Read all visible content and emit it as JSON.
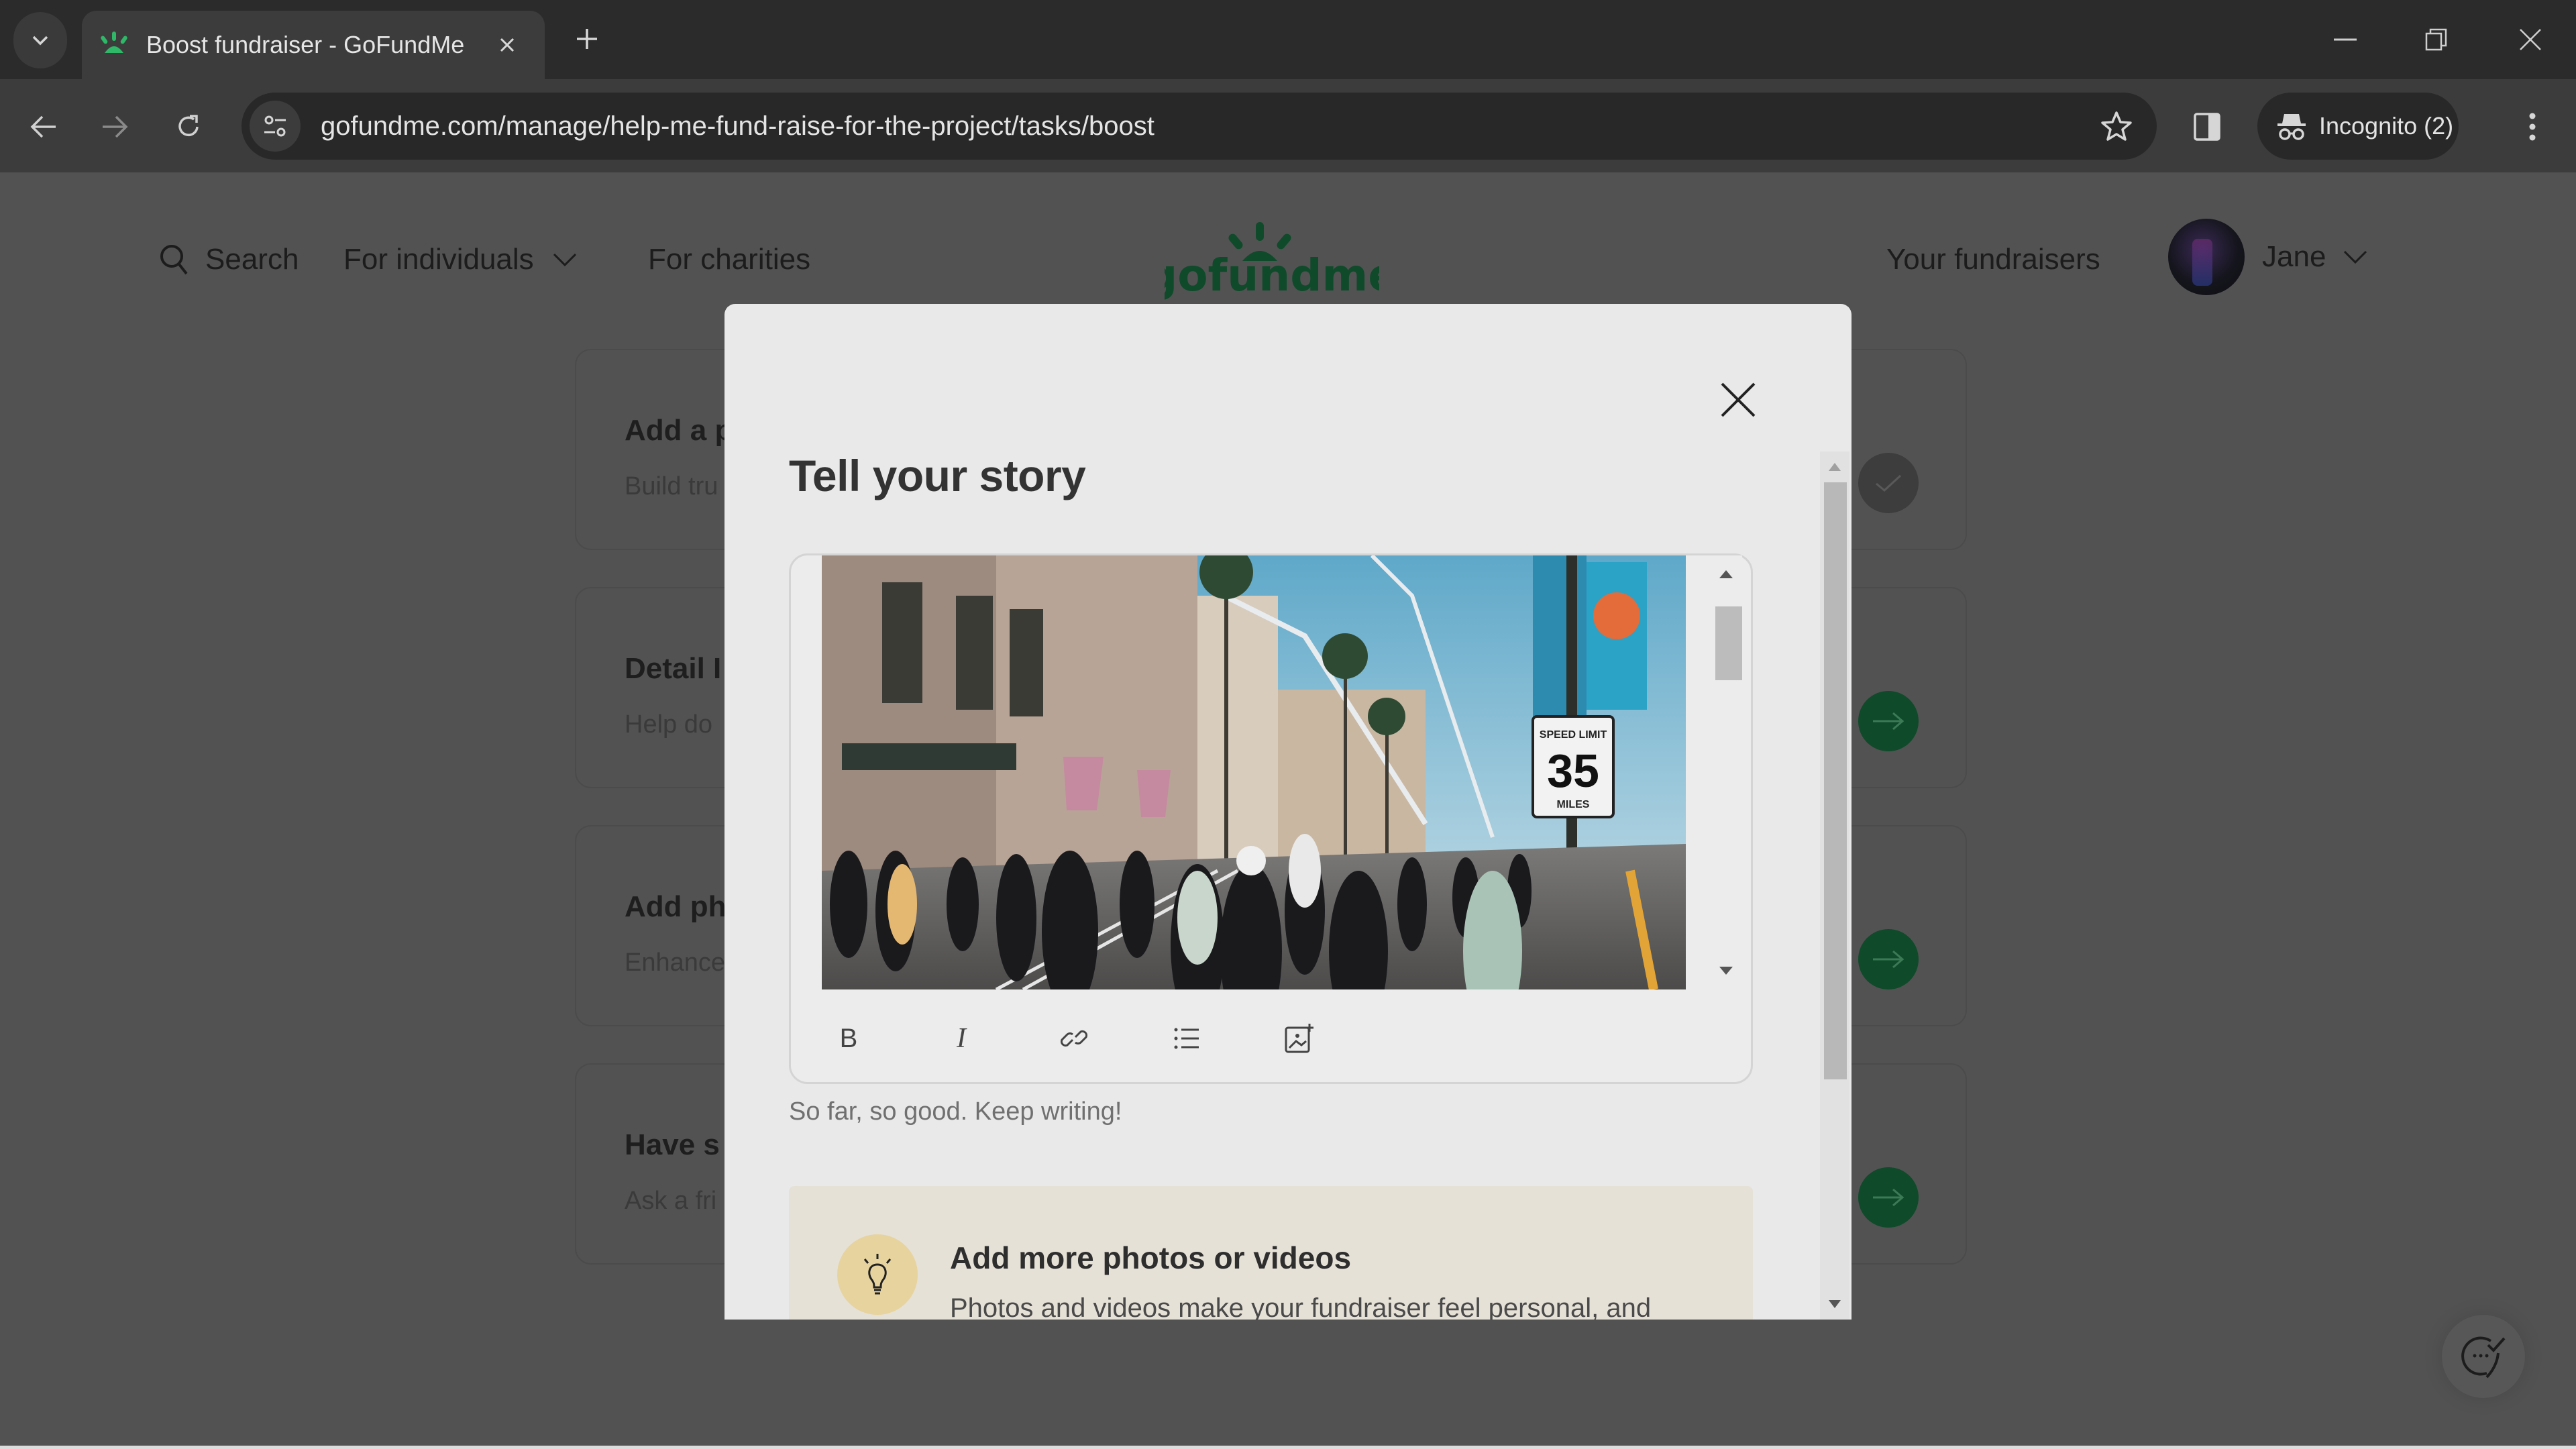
{
  "browser": {
    "tab": {
      "title": "Boost fundraiser - GoFundMe",
      "favicon": "gofundme-icon"
    },
    "new_tab_label": "+",
    "url": "gofundme.com/manage/help-me-fund-raise-for-the-project/tasks/boost",
    "profile": {
      "label": "Incognito (2)",
      "icon": "incognito-icon"
    },
    "window_controls": [
      "minimize",
      "restore",
      "close"
    ]
  },
  "site_header": {
    "search_label": "Search",
    "nav": [
      {
        "label": "For individuals",
        "has_dropdown": true
      },
      {
        "label": "For charities",
        "has_dropdown": false
      }
    ],
    "logo_text": "gofundme",
    "your_fundraisers": "Your fundraisers",
    "user": {
      "name": "Jane",
      "has_dropdown": true
    }
  },
  "tasks": [
    {
      "title": "Add a p",
      "description": "Build tru",
      "status": "done"
    },
    {
      "title": "Detail I",
      "description": "Help do",
      "status": "todo"
    },
    {
      "title": "Add ph",
      "description": "Enhance",
      "status": "todo"
    },
    {
      "title": "Have s",
      "description": "Ask a fri",
      "status": "todo"
    }
  ],
  "modal": {
    "title": "Tell your story",
    "editor": {
      "image_alt": "Crowd walking down a theme park street with palm trees and a 35 MPH speed limit sign",
      "speed_sign": {
        "top": "SPEED LIMIT",
        "number": "35",
        "bottom": "MILES"
      },
      "toolbar": [
        {
          "name": "bold",
          "label": "B"
        },
        {
          "name": "italic",
          "label": "I"
        },
        {
          "name": "link",
          "label": ""
        },
        {
          "name": "bulleted-list",
          "label": ""
        },
        {
          "name": "insert-image",
          "label": ""
        }
      ]
    },
    "helper_text": "So far, so good. Keep writing!",
    "tip": {
      "title": "Add more photos or videos",
      "body": "Photos and videos make your fundraiser feel personal, and"
    }
  },
  "colors": {
    "brand_green": "#0f4a2a",
    "modal_bg": "#e9e9e9",
    "tip_bg": "#e6e1d7",
    "tip_icon_bg": "#e7d39e",
    "overlay_page": "#525252"
  }
}
